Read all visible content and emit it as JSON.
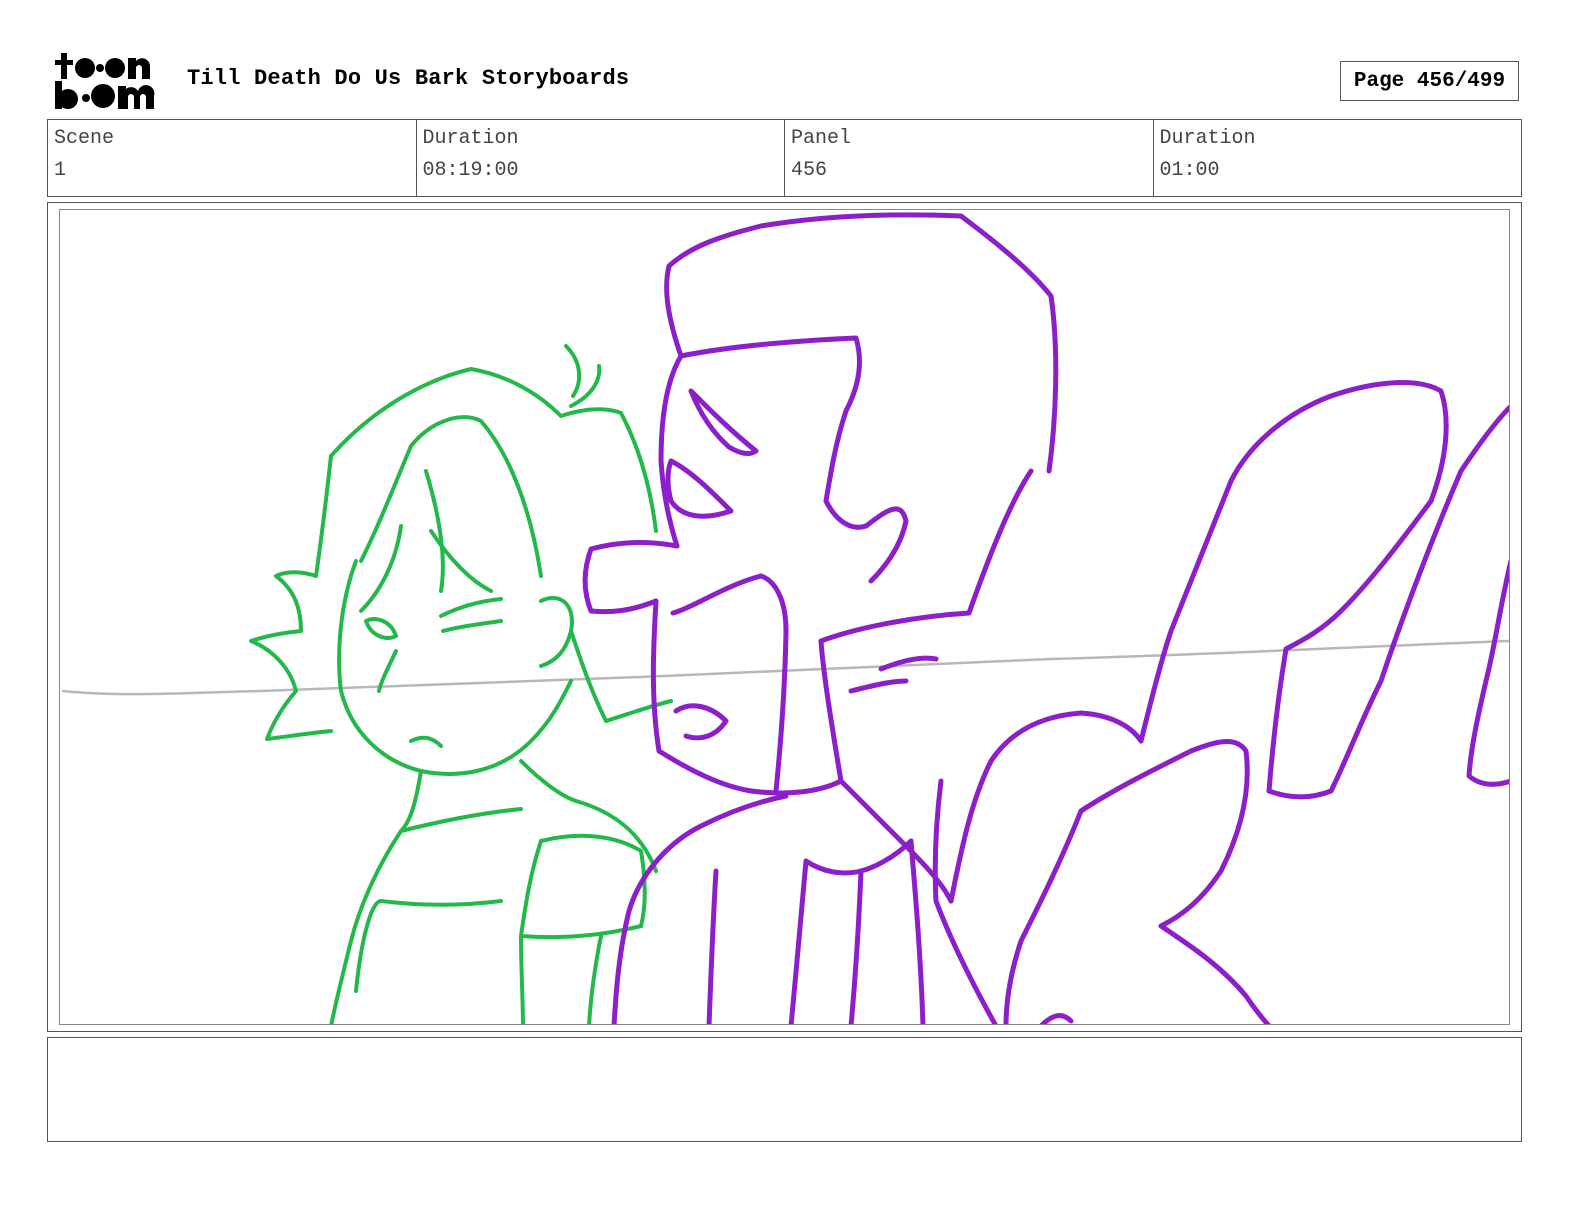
{
  "header": {
    "logo_text_top": "toon",
    "logo_text_bottom": "boom",
    "title": "Till Death Do Us Bark Storyboards",
    "page": "Page 456/499"
  },
  "info": {
    "scene_label": "Scene",
    "scene_value": "1",
    "scene_duration_label": "Duration",
    "scene_duration_value": "08:19:00",
    "panel_label": "Panel",
    "panel_value": "456",
    "panel_duration_label": "Duration",
    "panel_duration_value": "01:00"
  },
  "panel": {
    "colors": {
      "woman": "#22b84a",
      "man": "#8c1fc9",
      "horizon": "#b8b8b8"
    }
  },
  "notes": {
    "text": ""
  }
}
